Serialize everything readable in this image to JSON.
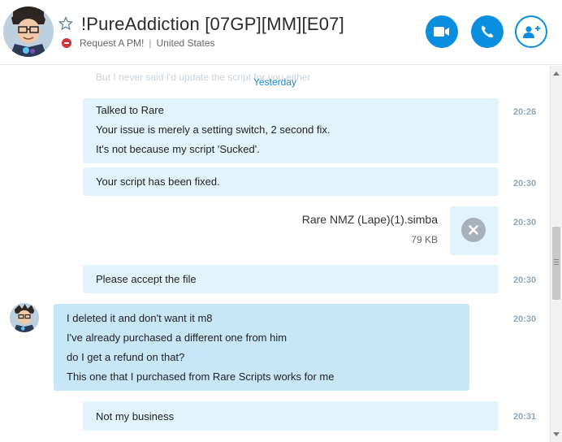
{
  "header": {
    "title": "!PureAddiction [07GP][MM][E07]",
    "mood": "Request A PM!",
    "separator": "|",
    "location": "United States"
  },
  "chat": {
    "ghost_text": "But I never said I'd update the script for you either",
    "date_divider": "Yesterday",
    "messages": [
      {
        "lines": [
          "Talked to Rare",
          "Your issue is merely a setting switch, 2 second fix.",
          "It's not because my script 'Sucked'."
        ],
        "time": "20:26"
      },
      {
        "lines": [
          "Your script has been fixed."
        ],
        "time": "20:30"
      },
      {
        "file_name": "Rare NMZ (Lape)(1).simba",
        "file_size": "79 KB",
        "time": "20:30"
      },
      {
        "lines": [
          "Please accept the file"
        ],
        "time": "20:30"
      },
      {
        "lines": [
          "I deleted it and don't want it m8",
          "I've already purchased a different one from him",
          "do I get a refund on that?",
          "This one that I purchased from Rare Scripts works for me"
        ],
        "time": "20:30"
      },
      {
        "lines": [
          "Not my business"
        ],
        "time": "20:31"
      }
    ]
  },
  "colors": {
    "accent": "#0a8ee0",
    "bubble_out": "#e3f3fc",
    "bubble_in": "#c7e7f8",
    "timestamp": "#8fa6b8",
    "dnd": "#d13438"
  },
  "icons": [
    "avatar",
    "favorite-star-icon",
    "do-not-disturb-icon",
    "video-call-icon",
    "audio-call-icon",
    "add-contact-icon",
    "file-cancel-icon"
  ]
}
